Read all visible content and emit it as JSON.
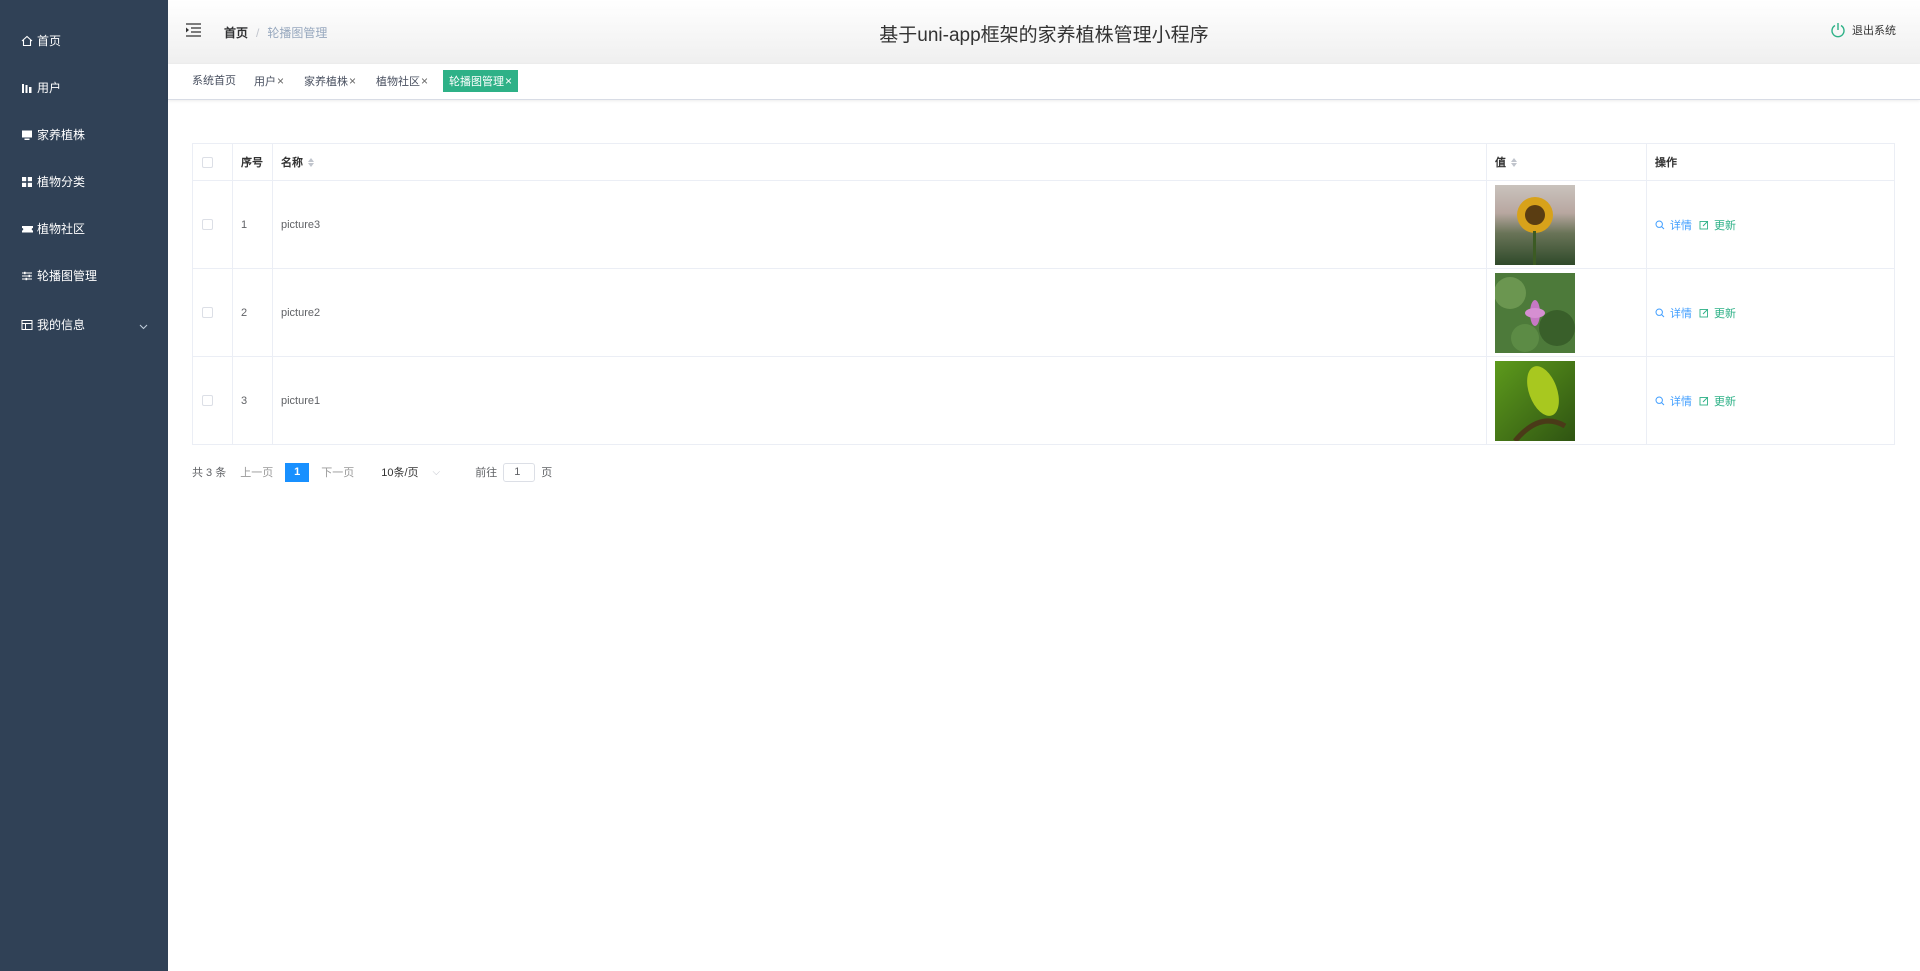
{
  "sidebar": {
    "items": [
      {
        "label": "首页",
        "icon": "home-icon"
      },
      {
        "label": "用户",
        "icon": "bar-chart-icon"
      },
      {
        "label": "家养植株",
        "icon": "monitor-icon"
      },
      {
        "label": "植物分类",
        "icon": "grid-icon"
      },
      {
        "label": "植物社区",
        "icon": "ticket-icon"
      },
      {
        "label": "轮播图管理",
        "icon": "sliders-icon"
      },
      {
        "label": "我的信息",
        "icon": "calendar-icon"
      }
    ]
  },
  "header": {
    "breadcrumb_home": "首页",
    "breadcrumb_separator": "/",
    "breadcrumb_current": "轮播图管理",
    "title": "基于uni-app框架的家养植株管理小程序",
    "logout": "退出系统"
  },
  "tags": [
    {
      "label": "系统首页",
      "closable": false,
      "active": false
    },
    {
      "label": "用户",
      "closable": true,
      "active": false
    },
    {
      "label": "家养植株",
      "closable": true,
      "active": false
    },
    {
      "label": "植物社区",
      "closable": true,
      "active": false
    },
    {
      "label": "轮播图管理",
      "closable": true,
      "active": true
    }
  ],
  "table": {
    "headers": {
      "index": "序号",
      "name": "名称",
      "value": "值",
      "actions": "操作"
    },
    "rows": [
      {
        "index": "1",
        "name": "picture3",
        "image": "sunflower"
      },
      {
        "index": "2",
        "name": "picture2",
        "image": "pink-flower"
      },
      {
        "index": "3",
        "name": "picture1",
        "image": "green-leaf"
      }
    ],
    "actions": {
      "detail": "详情",
      "update": "更新"
    }
  },
  "pagination": {
    "total": "共 3 条",
    "prev": "上一页",
    "current": "1",
    "next": "下一页",
    "page_size": "10条/页",
    "goto": "前往",
    "goto_value": "1",
    "page_unit": "页"
  },
  "colors": {
    "sidebar_bg": "#304156",
    "accent_green": "#2eb187",
    "accent_blue": "#409eff",
    "pager_active": "#1890ff"
  }
}
